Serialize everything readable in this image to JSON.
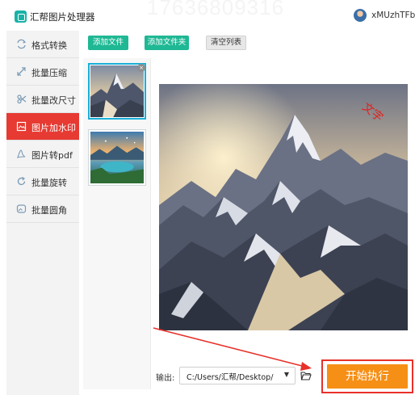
{
  "app": {
    "title": "汇帮图片处理器",
    "username": "xMUzhTFb",
    "top_watermark": "17636809316"
  },
  "sidebar": {
    "items": [
      {
        "label": "格式转换",
        "icon": "format-convert-icon",
        "active": false
      },
      {
        "label": "批量压缩",
        "icon": "compress-icon",
        "active": false
      },
      {
        "label": "批量改尺寸",
        "icon": "resize-icon",
        "active": false
      },
      {
        "label": "图片加水印",
        "icon": "watermark-icon",
        "active": true
      },
      {
        "label": "图片转pdf",
        "icon": "pdf-icon",
        "active": false
      },
      {
        "label": "批量旋转",
        "icon": "rotate-icon",
        "active": false
      },
      {
        "label": "批量圆角",
        "icon": "round-corner-icon",
        "active": false
      }
    ]
  },
  "toolbar": {
    "add_files": "添加文件",
    "add_folder": "添加文件夹",
    "clear_list": "清空列表"
  },
  "preview": {
    "watermark_text": "文字"
  },
  "output": {
    "label": "输出:",
    "path": "C:/Users/汇帮/Desktop/"
  },
  "actions": {
    "start": "开始执行"
  },
  "colors": {
    "accent_green": "#1fb894",
    "active_red": "#e63a32",
    "start_orange": "#f68f15",
    "highlight_red": "#e8312a",
    "thumb_selected": "#18b0d8"
  }
}
